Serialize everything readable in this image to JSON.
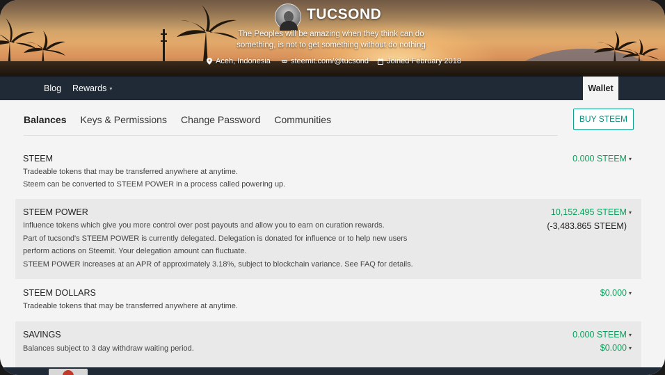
{
  "profile": {
    "username": "TUCSOND",
    "about": "The Peoples will be amazing when they think can do something, is not to get something without do nothing",
    "location": "Aceh, Indonesia",
    "website": "steemit.com/@tucsond",
    "joined": "Joined February 2018"
  },
  "nav": {
    "blog": "Blog",
    "rewards": "Rewards",
    "wallet": "Wallet"
  },
  "tabs": {
    "balances": "Balances",
    "keys": "Keys & Permissions",
    "password": "Change Password",
    "communities": "Communities"
  },
  "buy_button": "BUY STEEM",
  "balances": {
    "steem": {
      "title": "STEEM",
      "desc1": "Tradeable tokens that may be transferred anywhere at anytime.",
      "desc2": "Steem can be converted to STEEM POWER in a process called powering up.",
      "amount": "0.000 STEEM"
    },
    "steem_power": {
      "title": "STEEM POWER",
      "desc1": "Influence tokens which give you more control over post payouts and allow you to earn on curation rewards.",
      "desc2": "Part of tucsond's STEEM POWER is currently delegated. Delegation is donated for influence or to help new users",
      "desc3": "perform actions on Steemit. Your delegation amount can fluctuate.",
      "desc4": "STEEM POWER increases at an APR of approximately 3.18%, subject to blockchain variance. See FAQ for details.",
      "amount": "10,152.495 STEEM",
      "delegated": "(-3,483.865 STEEM)"
    },
    "steem_dollars": {
      "title": "STEEM DOLLARS",
      "desc1": "Tradeable tokens that may be transferred anywhere at anytime.",
      "amount": "$0.000"
    },
    "savings": {
      "title": "SAVINGS",
      "desc1": "Balances subject to 3 day withdraw waiting period.",
      "amount_steem": "0.000 STEEM",
      "amount_sbd": "$0.000"
    }
  },
  "colors": {
    "accent": "#07a05a",
    "button_border": "#0ea38f",
    "navbar": "#1f2a36"
  },
  "icons": {
    "caret": "▾"
  }
}
